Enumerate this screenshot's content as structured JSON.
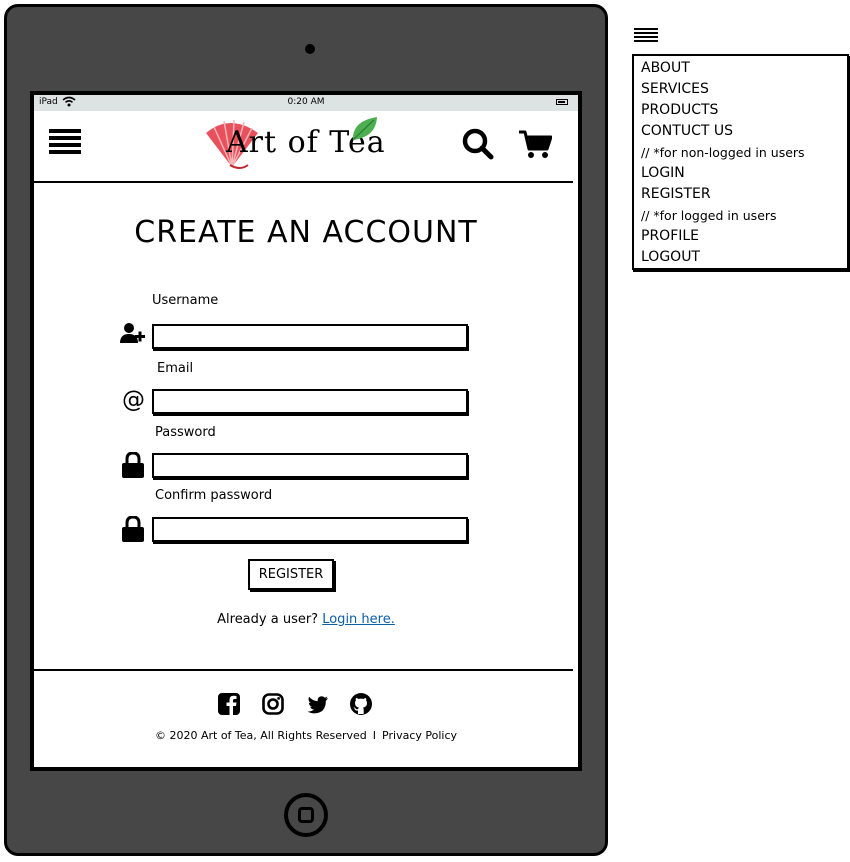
{
  "status_bar": {
    "device": "iPad",
    "time": "0:20 AM"
  },
  "header": {
    "logo_text": "Art of Tea"
  },
  "page": {
    "title": "CREATE AN ACCOUNT"
  },
  "form": {
    "username_label": "Username",
    "email_label": "Email",
    "password_label": "Password",
    "confirm_password_label": "Confirm password",
    "register_label": "REGISTER"
  },
  "login_prompt": {
    "text": "Already a user? ",
    "link": "Login here."
  },
  "footer": {
    "copyright": "© 2020 Art of Tea, All Rights Reserved",
    "separator": "I",
    "privacy": "Privacy Policy",
    "social": [
      "facebook-icon",
      "instagram-icon",
      "twitter-icon",
      "github-icon"
    ]
  },
  "menu": {
    "items": [
      "ABOUT",
      "SERVICES",
      "PRODUCTS",
      "CONTUCT US",
      "// *for non-logged in users",
      "LOGIN",
      "REGISTER",
      "// *for logged in users",
      "PROFILE",
      "LOGOUT"
    ]
  },
  "colors": {
    "tablet_frame": "#474747",
    "status_bar": "#dde2e2",
    "link": "#0b5ea8",
    "logo_red": "#e8515b",
    "logo_leaf": "#4caf50"
  }
}
